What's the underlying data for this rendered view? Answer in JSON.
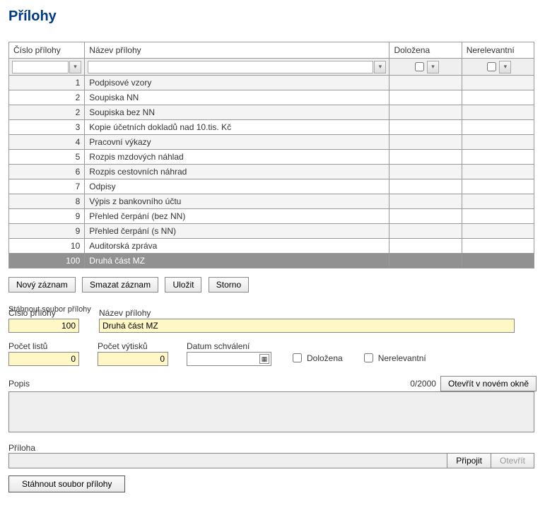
{
  "pageTitle": "Přílohy",
  "grid": {
    "headers": {
      "num": "Číslo přílohy",
      "name": "Název přílohy",
      "dol": "Doložena",
      "ner": "Nerelevantní"
    },
    "filterGlyph": "▾",
    "rows": [
      {
        "num": "1",
        "name": "Podpisové vzory"
      },
      {
        "num": "2",
        "name": "Soupiska NN"
      },
      {
        "num": "2",
        "name": "Soupiska bez NN"
      },
      {
        "num": "3",
        "name": "Kopie účetních dokladů nad 10.tis. Kč"
      },
      {
        "num": "4",
        "name": "Pracovní výkazy"
      },
      {
        "num": "5",
        "name": "Rozpis mzdových náhlad"
      },
      {
        "num": "6",
        "name": "Rozpis cestovních náhrad"
      },
      {
        "num": "7",
        "name": "Odpisy"
      },
      {
        "num": "8",
        "name": "Výpis z bankovního účtu"
      },
      {
        "num": "9",
        "name": "Přehled čerpání (bez NN)"
      },
      {
        "num": "9",
        "name": "Přehled čerpání (s NN)"
      },
      {
        "num": "10",
        "name": "Auditorská zpráva"
      },
      {
        "num": "100",
        "name": "Druhá část MZ",
        "selected": true
      }
    ]
  },
  "buttons": {
    "novy": "Nový záznam",
    "smazat": "Smazat záznam",
    "ulozit": "Uložit",
    "storno": "Storno",
    "otevritOkno": "Otevřít v novém okně",
    "pripojit": "Připojit",
    "otevrit": "Otevřít",
    "stahnout": "Stáhnout soubor přílohy"
  },
  "topLink": "Stáhnout soubor přílohy",
  "form": {
    "cislo": {
      "label": "Číslo přílohy",
      "value": "100"
    },
    "nazev": {
      "label": "Název přílohy",
      "value": "Druhá část MZ"
    },
    "listu": {
      "label": "Počet listů",
      "value": "0"
    },
    "vytisku": {
      "label": "Počet výtisků",
      "value": "0"
    },
    "datum": {
      "label": "Datum schválení",
      "value": ""
    },
    "dolozena": "Doložena",
    "nerelevantni": "Nerelevantní",
    "popisLabel": "Popis",
    "popisCount": "0/2000",
    "popisValue": "",
    "prilohaLabel": "Příloha",
    "prilohaValue": ""
  }
}
